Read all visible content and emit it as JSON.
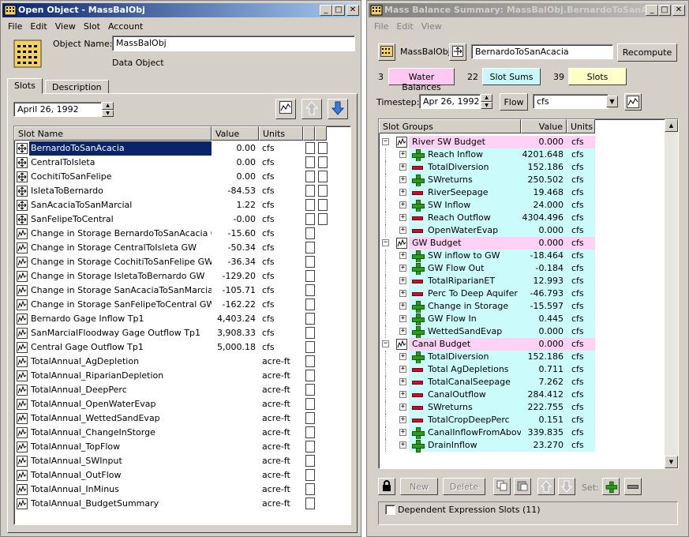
{
  "left": {
    "title": "Open Object - MassBalObj",
    "menu": [
      "File",
      "Edit",
      "View",
      "Slot",
      "Account"
    ],
    "object_name_label": "Object Name:",
    "object_name": "MassBalObj",
    "object_type": "Data Object",
    "tabs": [
      "Slots",
      "Description"
    ],
    "date": "April 26, 1992",
    "columns": [
      "Slot Name",
      "Value",
      "Units"
    ],
    "rows": [
      {
        "icon": "series-slot-icon",
        "name": "BernardoToSanAcacia",
        "value": "0.00",
        "units": "cfs"
      },
      {
        "icon": "series-slot-icon",
        "name": "CentralToIsleta",
        "value": "0.00",
        "units": "cfs"
      },
      {
        "icon": "series-slot-icon",
        "name": "CochitiToSanFelipe",
        "value": "0.00",
        "units": "cfs"
      },
      {
        "icon": "series-slot-icon",
        "name": "IsletaToBernardo",
        "value": "-84.53",
        "units": "cfs"
      },
      {
        "icon": "series-slot-icon",
        "name": "SanAcaciaToSanMarcial",
        "value": "1.22",
        "units": "cfs"
      },
      {
        "icon": "series-slot-icon",
        "name": "SanFelipeToCentral",
        "value": "-0.00",
        "units": "cfs"
      },
      {
        "icon": "graph-slot-icon",
        "name": "Change in Storage BernardoToSanAcacia GW",
        "value": "-15.60",
        "units": "cfs"
      },
      {
        "icon": "graph-slot-icon",
        "name": "Change in Storage CentralToIsleta GW",
        "value": "-50.34",
        "units": "cfs"
      },
      {
        "icon": "graph-slot-icon",
        "name": "Change in Storage CochitiToSanFelipe GW",
        "value": "-36.34",
        "units": "cfs"
      },
      {
        "icon": "graph-slot-icon",
        "name": "Change in Storage IsletaToBernardo GW",
        "value": "-129.20",
        "units": "cfs"
      },
      {
        "icon": "graph-slot-icon",
        "name": "Change in Storage SanAcaciaToSanMarcial GW",
        "value": "-105.71",
        "units": "cfs"
      },
      {
        "icon": "graph-slot-icon",
        "name": "Change in Storage SanFelipeToCentral GW",
        "value": "-162.22",
        "units": "cfs"
      },
      {
        "icon": "graph-slot-icon",
        "name": "Bernardo Gage Inflow Tp1",
        "value": "4,403.24",
        "units": "cfs"
      },
      {
        "icon": "graph-slot-icon",
        "name": "SanMarcialFloodway Gage Outflow Tp1",
        "value": "3,908.33",
        "units": "cfs"
      },
      {
        "icon": "graph-slot-icon",
        "name": "Central Gage Outflow Tp1",
        "value": "5,000.18",
        "units": "cfs"
      },
      {
        "icon": "graph-slot-icon",
        "name": "TotalAnnual_AgDepletion",
        "value": "",
        "units": "acre-ft"
      },
      {
        "icon": "graph-slot-icon",
        "name": "TotalAnnual_RiparianDepletion",
        "value": "",
        "units": "acre-ft"
      },
      {
        "icon": "graph-slot-icon",
        "name": "TotalAnnual_DeepPerc",
        "value": "",
        "units": "acre-ft"
      },
      {
        "icon": "graph-slot-icon",
        "name": "TotalAnnual_OpenWaterEvap",
        "value": "",
        "units": "acre-ft"
      },
      {
        "icon": "graph-slot-icon",
        "name": "TotalAnnual_WettedSandEvap",
        "value": "",
        "units": "acre-ft"
      },
      {
        "icon": "graph-slot-icon",
        "name": "TotalAnnual_ChangeInStorge",
        "value": "",
        "units": "acre-ft"
      },
      {
        "icon": "graph-slot-icon",
        "name": "TotalAnnual_TopFlow",
        "value": "",
        "units": "acre-ft"
      },
      {
        "icon": "graph-slot-icon",
        "name": "TotalAnnual_SWInput",
        "value": "",
        "units": "acre-ft"
      },
      {
        "icon": "graph-slot-icon",
        "name": "TotalAnnual_OutFlow",
        "value": "",
        "units": "acre-ft"
      },
      {
        "icon": "graph-slot-icon",
        "name": "TotalAnnual_InMinus",
        "value": "",
        "units": "acre-ft"
      },
      {
        "icon": "graph-slot-icon",
        "name": "TotalAnnual_BudgetSummary",
        "value": "",
        "units": "acre-ft"
      }
    ]
  },
  "right": {
    "title": "Mass Balance Summary: MassBalObj.BernardoToSanAca...",
    "menu": [
      "File",
      "Edit",
      "View"
    ],
    "object": "MassBalObj",
    "slot": "BernardoToSanAcacia",
    "recompute": "Recompute",
    "counts": [
      {
        "n": "3",
        "label": "Water Balances",
        "color": "#ffc8f0"
      },
      {
        "n": "22",
        "label": "Slot Sums",
        "color": "#c8f8f8"
      },
      {
        "n": "39",
        "label": "Slots",
        "color": "#ffffc8"
      }
    ],
    "timestep_label": "Timestep:",
    "timestep": "Apr 26, 1992",
    "flow_label": "Flow",
    "flow_unit": "cfs",
    "columns": [
      "Slot Groups",
      "Value",
      "Units"
    ],
    "groups": [
      {
        "name": "River SW Budget",
        "value": "0.000",
        "units": "cfs",
        "items": [
          {
            "sign": "+",
            "name": "Reach Inflow",
            "value": "4201.648",
            "units": "cfs"
          },
          {
            "sign": "-",
            "name": "TotalDiversion",
            "value": "152.186",
            "units": "cfs"
          },
          {
            "sign": "+",
            "name": "SWreturns",
            "value": "250.502",
            "units": "cfs"
          },
          {
            "sign": "-",
            "name": "RiverSeepage",
            "value": "19.468",
            "units": "cfs"
          },
          {
            "sign": "+",
            "name": "SW Inflow",
            "value": "24.000",
            "units": "cfs"
          },
          {
            "sign": "-",
            "name": "Reach Outflow",
            "value": "4304.496",
            "units": "cfs"
          },
          {
            "sign": "-",
            "name": "OpenWaterEvap",
            "value": "0.000",
            "units": "cfs"
          }
        ]
      },
      {
        "name": "GW Budget",
        "value": "0.000",
        "units": "cfs",
        "items": [
          {
            "sign": "+",
            "name": "SW inflow to GW",
            "value": "-18.464",
            "units": "cfs"
          },
          {
            "sign": "+",
            "name": "GW Flow Out",
            "value": "-0.184",
            "units": "cfs"
          },
          {
            "sign": "-",
            "name": "TotalRiparianET",
            "value": "12.993",
            "units": "cfs"
          },
          {
            "sign": "-",
            "name": "Perc To Deep Aquifer",
            "value": "-46.793",
            "units": "cfs"
          },
          {
            "sign": "+",
            "name": "Change in Storage",
            "value": "-15.597",
            "units": "cfs"
          },
          {
            "sign": "+",
            "name": "GW Flow In",
            "value": "0.445",
            "units": "cfs"
          },
          {
            "sign": "+",
            "name": "WettedSandEvap",
            "value": "0.000",
            "units": "cfs"
          }
        ]
      },
      {
        "name": "Canal Budget",
        "value": "0.000",
        "units": "cfs",
        "items": [
          {
            "sign": "+",
            "name": "TotalDiversion",
            "value": "152.186",
            "units": "cfs"
          },
          {
            "sign": "-",
            "name": "Total AgDepletions",
            "value": "0.711",
            "units": "cfs"
          },
          {
            "sign": "-",
            "name": "TotalCanalSeepage",
            "value": "7.262",
            "units": "cfs"
          },
          {
            "sign": "-",
            "name": "CanalOutflow",
            "value": "284.412",
            "units": "cfs"
          },
          {
            "sign": "-",
            "name": "SWreturns",
            "value": "222.755",
            "units": "cfs"
          },
          {
            "sign": "-",
            "name": "TotalCropDeepPerc",
            "value": "0.151",
            "units": "cfs"
          },
          {
            "sign": "+",
            "name": "CanalInflowFromAbove",
            "value": "339.835",
            "units": "cfs"
          },
          {
            "sign": "+",
            "name": "DrainInflow",
            "value": "23.270",
            "units": "cfs"
          }
        ]
      }
    ],
    "buttons": {
      "new": "New",
      "delete": "Delete",
      "set_label": "Set:"
    },
    "dependent": "Dependent Expression Slots (11)"
  },
  "colors": {
    "group_bg": "#ffd2f5",
    "item_bg": "#ccfbfb",
    "selection": "#0a246a"
  }
}
